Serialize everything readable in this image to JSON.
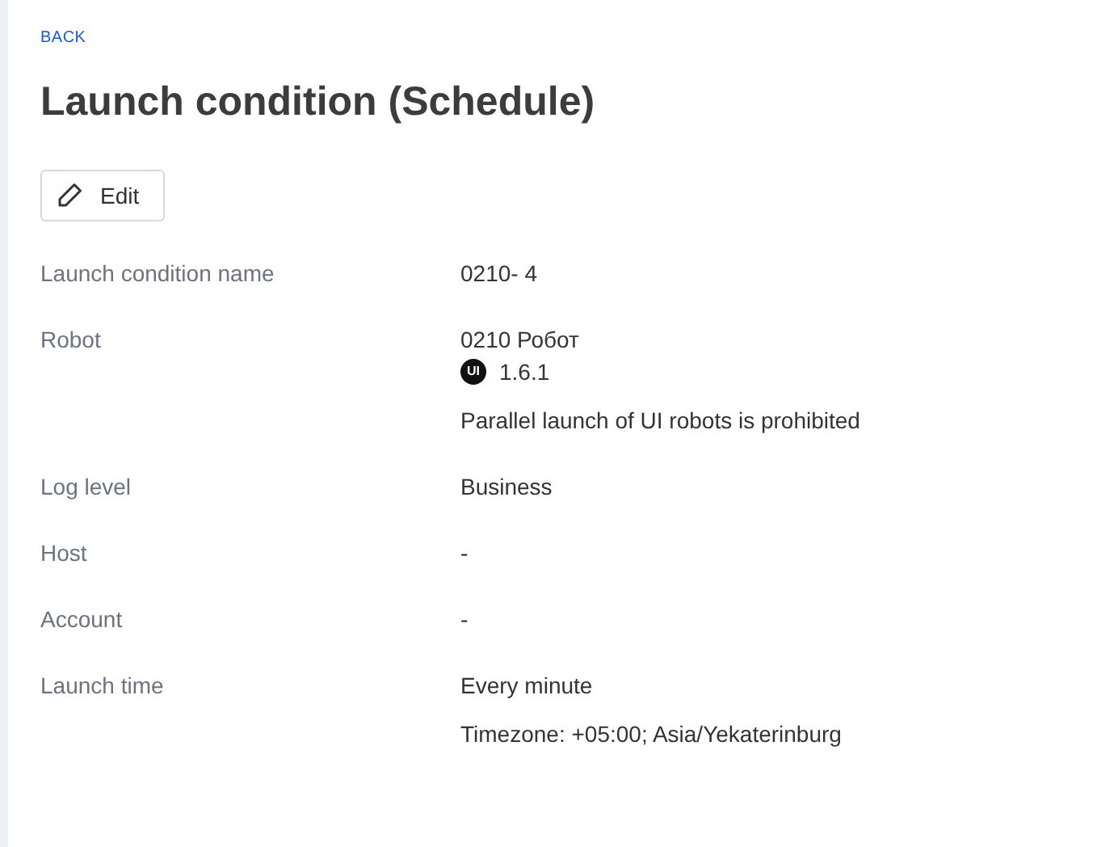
{
  "back_link": "BACK",
  "title": "Launch condition (Schedule)",
  "edit_button": "Edit",
  "fields": [
    {
      "label": "Launch condition name",
      "values": [
        {
          "kind": "text",
          "text": "0210- 4"
        }
      ]
    },
    {
      "label": "Robot",
      "values": [
        {
          "kind": "text",
          "text": "0210 Робот"
        },
        {
          "kind": "version",
          "badge": "UI",
          "text": "1.6.1"
        },
        {
          "kind": "note",
          "text": "Parallel launch of UI robots is prohibited"
        }
      ]
    },
    {
      "label": "Log level",
      "values": [
        {
          "kind": "text",
          "text": "Business"
        }
      ]
    },
    {
      "label": "Host",
      "values": [
        {
          "kind": "text",
          "text": "-"
        }
      ]
    },
    {
      "label": "Account",
      "values": [
        {
          "kind": "text",
          "text": "-"
        }
      ]
    },
    {
      "label": "Launch time",
      "values": [
        {
          "kind": "text",
          "text": "Every minute"
        },
        {
          "kind": "note",
          "text": "Timezone: +05:00; Asia/Yekaterinburg"
        }
      ]
    }
  ]
}
